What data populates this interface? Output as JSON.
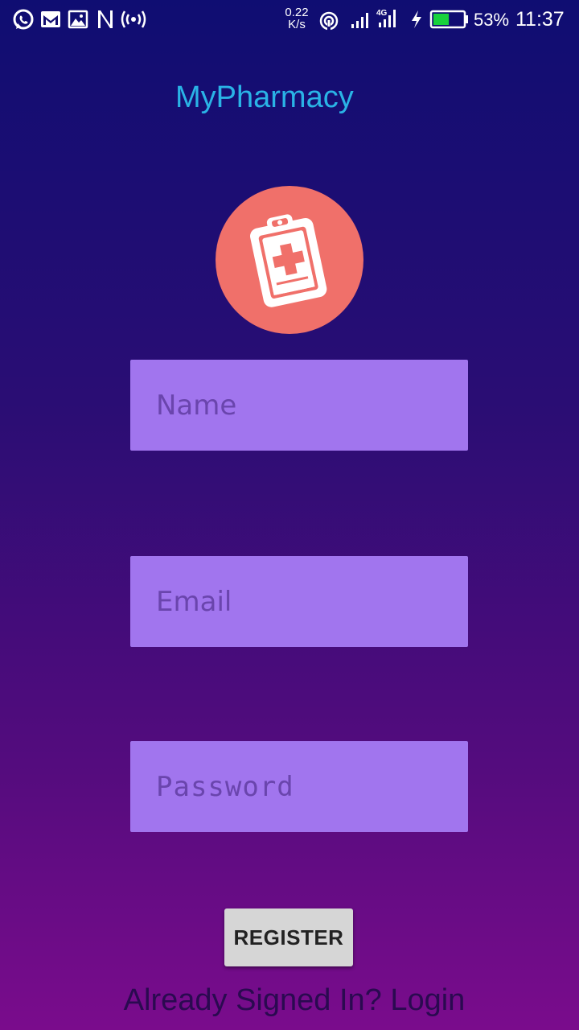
{
  "status_bar": {
    "speed_value": "0.22",
    "speed_unit": "K/s",
    "network_type": "4G",
    "battery_percent": "53%",
    "time": "11:37",
    "battery_level": 0.53,
    "icons": [
      "whatsapp-icon",
      "gmail-icon",
      "gallery-icon",
      "n-notification-icon",
      "hotspot-icon",
      "wifi-icon",
      "signal-icon",
      "signal-4g-icon",
      "charging-icon",
      "battery-icon"
    ]
  },
  "app": {
    "title": "MyPharmacy",
    "logo_icon": "clipboard-medical-icon",
    "logo_color": "#f0706a",
    "title_color": "#2ab3e6"
  },
  "form": {
    "name_placeholder": "Name",
    "email_placeholder": "Email",
    "password_placeholder": "Password",
    "field_color": "#a175ee"
  },
  "actions": {
    "register_label": "REGISTER",
    "login_link": "Already Signed In? Login"
  }
}
